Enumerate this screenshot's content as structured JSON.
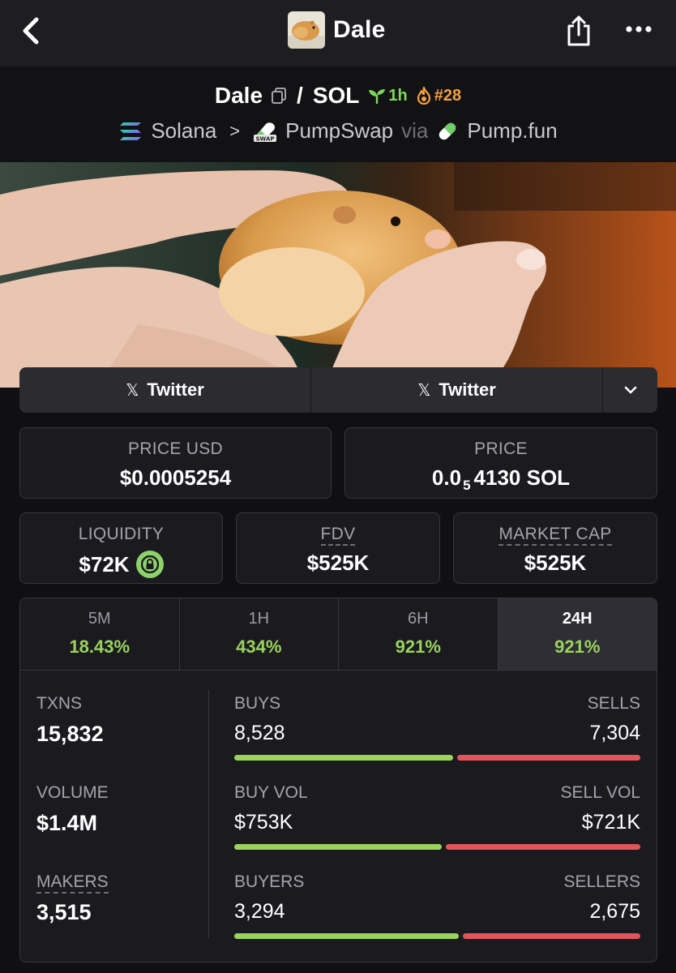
{
  "header": {
    "title": "Dale"
  },
  "pair": {
    "base": "Dale",
    "separator": "/",
    "quote": "SOL",
    "age": "1h",
    "rank": "#28",
    "chain": "Solana",
    "dex": "PumpSwap",
    "via": "via",
    "launchpad": "Pump.fun"
  },
  "socials": {
    "link1": "Twitter",
    "link2": "Twitter"
  },
  "price": {
    "usd_label": "PRICE USD",
    "usd_value": "$0.0005254",
    "native_label": "PRICE",
    "native_prefix": "0.0",
    "native_zeros": "5",
    "native_suffix": "4130 SOL"
  },
  "metrics": {
    "liquidity_label": "LIQUIDITY",
    "liquidity_value": "$72K",
    "fdv_label": "FDV",
    "fdv_value": "$525K",
    "mcap_label": "MARKET CAP",
    "mcap_value": "$525K"
  },
  "tabs": [
    {
      "label": "5M",
      "value": "18.43%"
    },
    {
      "label": "1H",
      "value": "434%"
    },
    {
      "label": "6H",
      "value": "921%"
    },
    {
      "label": "24H",
      "value": "921%"
    }
  ],
  "active_tab": "24H",
  "stats": {
    "txns_label": "TXNS",
    "txns_value": "15,832",
    "volume_label": "VOLUME",
    "volume_value": "$1.4M",
    "makers_label": "MAKERS",
    "makers_value": "3,515",
    "buys_label": "BUYS",
    "buys_value": "8,528",
    "sells_label": "SELLS",
    "sells_value": "7,304",
    "buy_vol_label": "BUY VOL",
    "buy_vol_value": "$753K",
    "sell_vol_label": "SELL VOL",
    "sell_vol_value": "$721K",
    "buyers_label": "BUYERS",
    "buyers_value": "3,294",
    "sellers_label": "SELLERS",
    "sellers_value": "2,675"
  },
  "ratios": {
    "buys_share": 0.539,
    "buy_vol_share": 0.511,
    "buyers_share": 0.552
  },
  "colors": {
    "positive": "#9bd45c",
    "negative": "#e2555a",
    "age_badge": "#7ed957",
    "rank_badge": "#f5a23a"
  },
  "icons": [
    "back-chevron-icon",
    "share-icon",
    "more-icon",
    "copy-icon",
    "seedling-icon",
    "flame-icon",
    "solana-logo-icon",
    "pumpswap-logo-icon",
    "pill-icon",
    "x-logo-icon",
    "chevron-down-icon",
    "lock-icon"
  ]
}
